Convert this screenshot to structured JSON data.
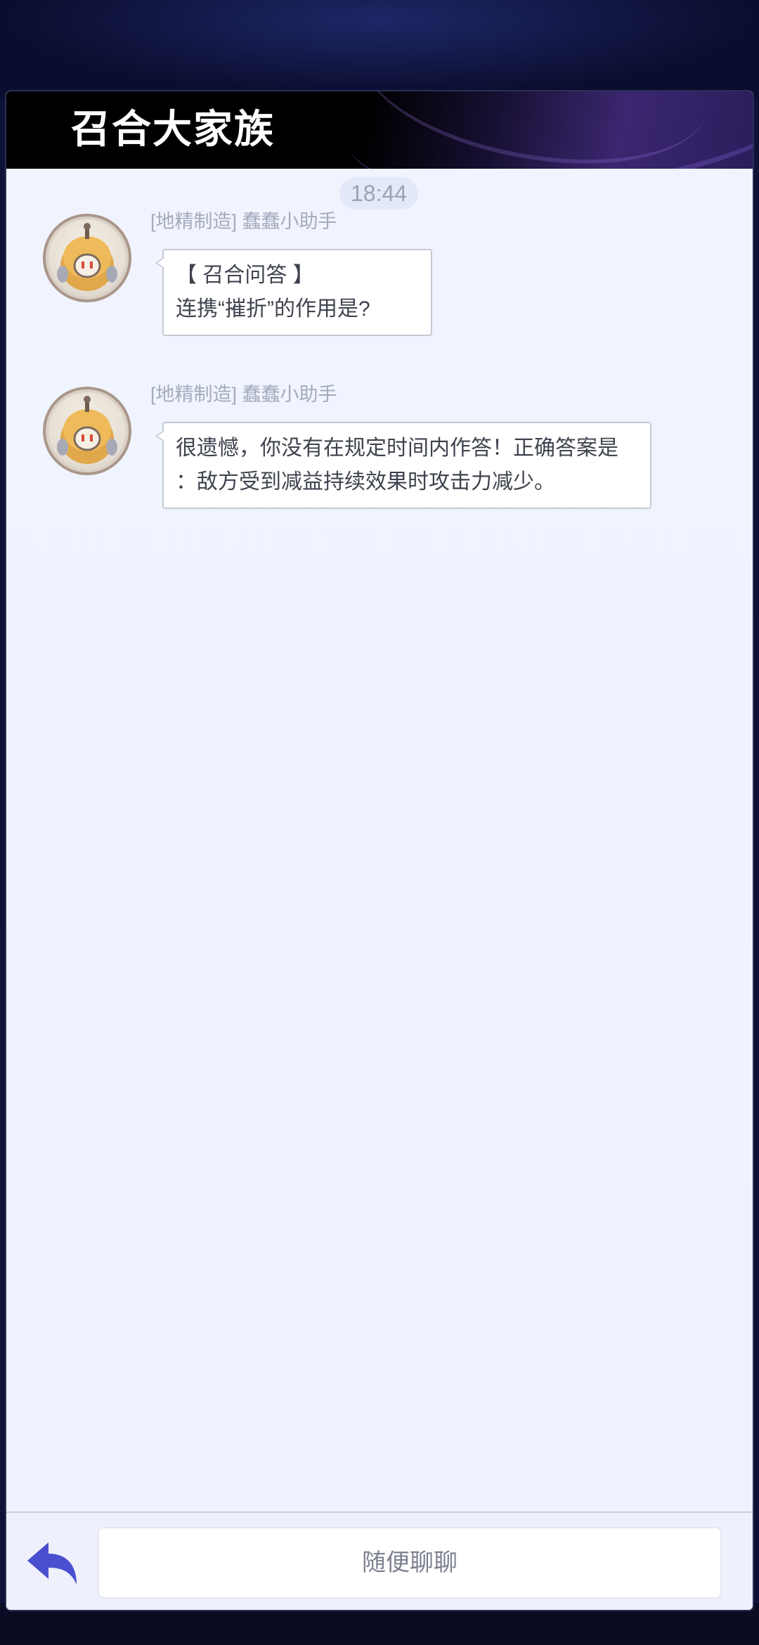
{
  "header": {
    "title": "召合大家族"
  },
  "chat": {
    "timestamp": "18:44",
    "messages": [
      {
        "sender": "[地精制造] 蠢蠢小助手",
        "lines": [
          "【 召合问答 】",
          "连携“摧折”的作用是?"
        ]
      },
      {
        "sender": "[地精制造] 蠢蠢小助手",
        "lines": [
          "很遗憾，你没有在规定时间内作答！正确答案是",
          "：敌方受到减益持续效果时攻击力减少。"
        ]
      }
    ]
  },
  "footer": {
    "input_placeholder": "随便聊聊",
    "back_icon": "back-arrow-icon"
  },
  "colors": {
    "accent": "#4a4fd0",
    "chat_background": "#eff3ff",
    "header_background": "#000000"
  }
}
